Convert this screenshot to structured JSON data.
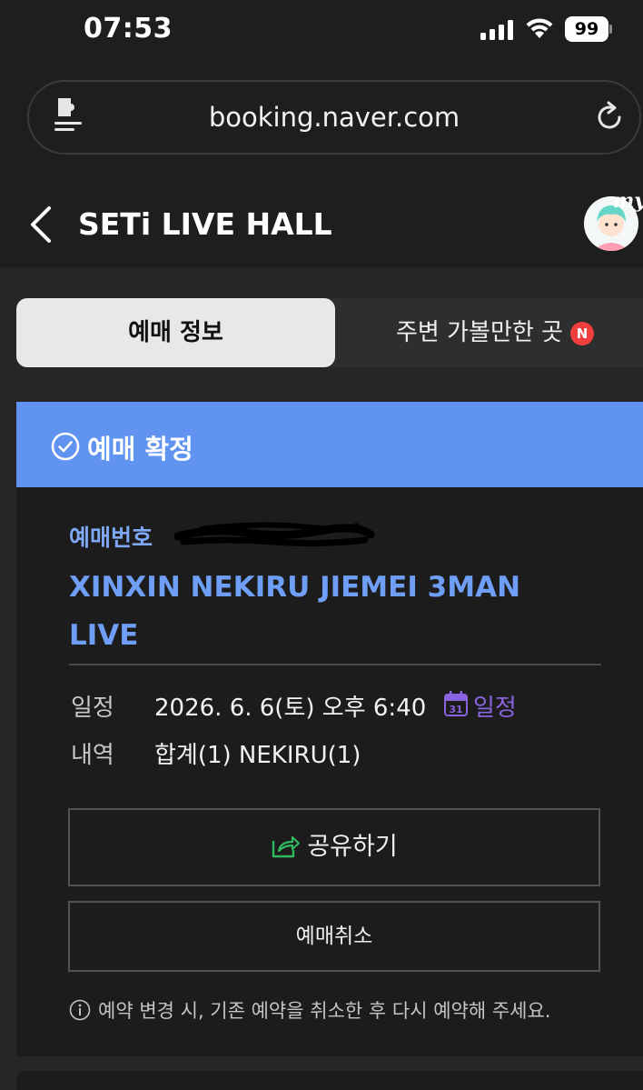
{
  "status_bar": {
    "time": "07:53",
    "battery": "99"
  },
  "browser": {
    "url": "booking.naver.com"
  },
  "header": {
    "title": "SETi LIVE HALL",
    "avatar_label": "my"
  },
  "tabs": [
    {
      "label": "예매 정보",
      "active": true
    },
    {
      "label": "주변 가볼만한 곳",
      "active": false,
      "badge": "N"
    }
  ],
  "booking": {
    "status": "예매 확정",
    "number_label": "예매번호",
    "event_title": "XINXIN NEKIRU JIEMEI 3MAN LIVE",
    "schedule_label": "일정",
    "schedule_value": "2026. 6. 6(토) 오후 6:40",
    "calendar_day": "31",
    "calendar_link": "일정",
    "details_label": "내역",
    "details_value": "합계(1) NEKIRU(1)",
    "share_button": "공유하기",
    "cancel_button": "예매취소",
    "notice": "예약 변경 시, 기존 예약을 취소한 후 다시 예약해 주세요."
  },
  "colors": {
    "accent_blue": "#6094f0",
    "title_blue": "#6e9ef6",
    "calendar_purple": "#8a63e0",
    "badge_red": "#ef3e3e"
  }
}
